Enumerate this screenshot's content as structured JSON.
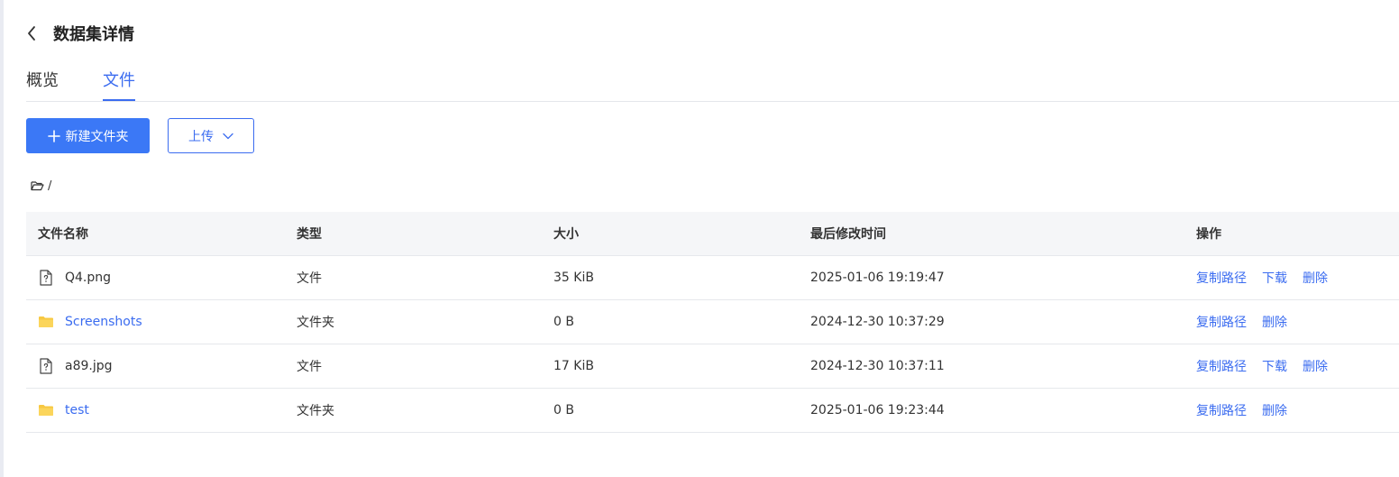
{
  "header": {
    "title": "数据集详情"
  },
  "tabs": [
    {
      "label": "概览",
      "active": false
    },
    {
      "label": "文件",
      "active": true
    }
  ],
  "toolbar": {
    "new_folder_label": "新建文件夹",
    "upload_label": "上传"
  },
  "path": {
    "separator": "/"
  },
  "table": {
    "columns": [
      "文件名称",
      "类型",
      "大小",
      "最后修改时间",
      "操作"
    ],
    "rows": [
      {
        "name": "Q4.png",
        "kind": "file",
        "type": "文件",
        "size": "35 KiB",
        "modified": "2025-01-06 19:19:47",
        "actions": [
          "复制路径",
          "下载",
          "删除"
        ]
      },
      {
        "name": "Screenshots",
        "kind": "folder",
        "type": "文件夹",
        "size": "0 B",
        "modified": "2024-12-30 10:37:29",
        "actions": [
          "复制路径",
          "删除"
        ]
      },
      {
        "name": "a89.jpg",
        "kind": "file",
        "type": "文件",
        "size": "17 KiB",
        "modified": "2024-12-30 10:37:11",
        "actions": [
          "复制路径",
          "下载",
          "删除"
        ]
      },
      {
        "name": "test",
        "kind": "folder",
        "type": "文件夹",
        "size": "0 B",
        "modified": "2025-01-06 19:23:44",
        "actions": [
          "复制路径",
          "删除"
        ]
      }
    ]
  },
  "colors": {
    "accent": "#3b6cf0",
    "primary_button": "#3b78f6",
    "folder": "#f7c842",
    "header_bg": "#f5f6f8"
  },
  "icons": {
    "back": "chevron-left-icon",
    "new_folder": "plus-icon",
    "upload_dropdown": "chevron-down-icon",
    "path": "folder-open-icon",
    "file": "unknown-file-icon",
    "folder": "folder-icon"
  }
}
